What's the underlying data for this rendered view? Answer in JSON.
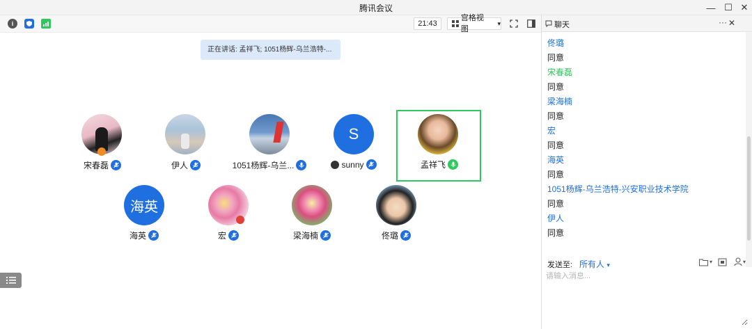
{
  "window": {
    "title": "腾讯会议",
    "minimize": "—",
    "maximize": "☐",
    "close": "✕"
  },
  "toolbar": {
    "info_glyph": "i",
    "time": "21:43",
    "view_label": "宫格视图",
    "view_caret": "▾"
  },
  "speaking": {
    "text": "正在讲话: 孟祥飞; 1051杨辉-乌兰浩特-..."
  },
  "participants": [
    {
      "name": "宋春磊",
      "initial": ""
    },
    {
      "name": "伊人",
      "initial": ""
    },
    {
      "name": "1051杨辉-乌兰...",
      "initial": ""
    },
    {
      "name": "sunny",
      "initial": "S"
    },
    {
      "name": "孟祥飞",
      "initial": ""
    },
    {
      "name": "海英",
      "initial": "海英"
    },
    {
      "name": "宏",
      "initial": ""
    },
    {
      "name": "梁海楠",
      "initial": ""
    },
    {
      "name": "佟璐",
      "initial": ""
    }
  ],
  "chat": {
    "title": "聊天",
    "more": "···",
    "close": "✕",
    "messages": [
      {
        "text": "佟璐",
        "type": "name"
      },
      {
        "text": "同意",
        "type": "text"
      },
      {
        "text": "宋春磊",
        "type": "name-green"
      },
      {
        "text": "同意",
        "type": "text"
      },
      {
        "text": "梁海楠",
        "type": "name"
      },
      {
        "text": "同意",
        "type": "text"
      },
      {
        "text": "宏",
        "type": "name"
      },
      {
        "text": "同意",
        "type": "text"
      },
      {
        "text": "海英",
        "type": "name"
      },
      {
        "text": "同意",
        "type": "text"
      },
      {
        "text": "1051杨辉-乌兰浩特-兴安职业技术学院",
        "type": "name"
      },
      {
        "text": "同意",
        "type": "text"
      },
      {
        "text": "伊人",
        "type": "name"
      },
      {
        "text": "同意",
        "type": "text"
      }
    ],
    "send_to_label": "发送至:",
    "send_to_value": "所有人",
    "send_to_caret": "▾",
    "placeholder": "请输入消息..."
  },
  "colors": {
    "accent": "#1f6fe0",
    "speaking_green": "#2ec95c",
    "speaking_bg": "#dbe9fb"
  }
}
